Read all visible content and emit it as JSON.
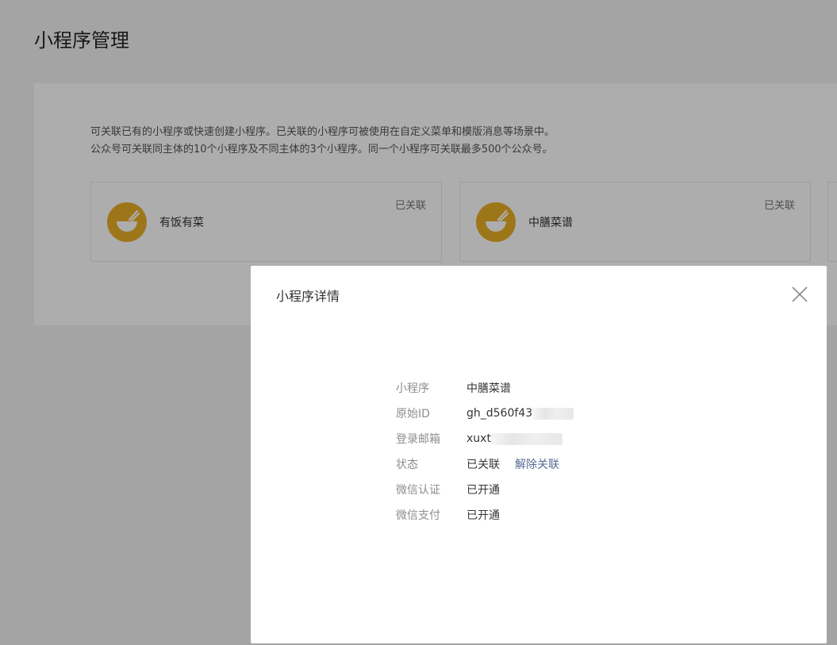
{
  "page": {
    "title": "小程序管理"
  },
  "description": {
    "line1": "可关联已有的小程序或快速创建小程序。已关联的小程序可被使用在自定义菜单和模版消息等场景中。",
    "line2": "公众号可关联同主体的10个小程序及不同主体的3个小程序。同一个小程序可关联最多500个公众号。"
  },
  "cards": [
    {
      "name": "有饭有菜",
      "status": "已关联",
      "logo_icon": "rice-bowl-icon"
    },
    {
      "name": "中膳菜谱",
      "status": "已关联",
      "logo_icon": "rice-bowl-icon"
    }
  ],
  "colors": {
    "logo": "#e9ae27",
    "link": "#576b95",
    "mask": "rgba(0,0,0,0.32)"
  },
  "dialog": {
    "title": "小程序详情",
    "close_icon": "close-icon",
    "fields": {
      "mini_program": {
        "label": "小程序",
        "value": "中膳菜谱"
      },
      "original_id": {
        "label": "原始ID",
        "value": "gh_d560f43"
      },
      "email": {
        "label": "登录邮箱",
        "value": "xuxt"
      },
      "status": {
        "label": "状态",
        "value": "已关联",
        "action": "解除关联"
      },
      "wechat_verify": {
        "label": "微信认证",
        "value": "已开通"
      },
      "wechat_pay": {
        "label": "微信支付",
        "value": "已开通"
      }
    }
  }
}
